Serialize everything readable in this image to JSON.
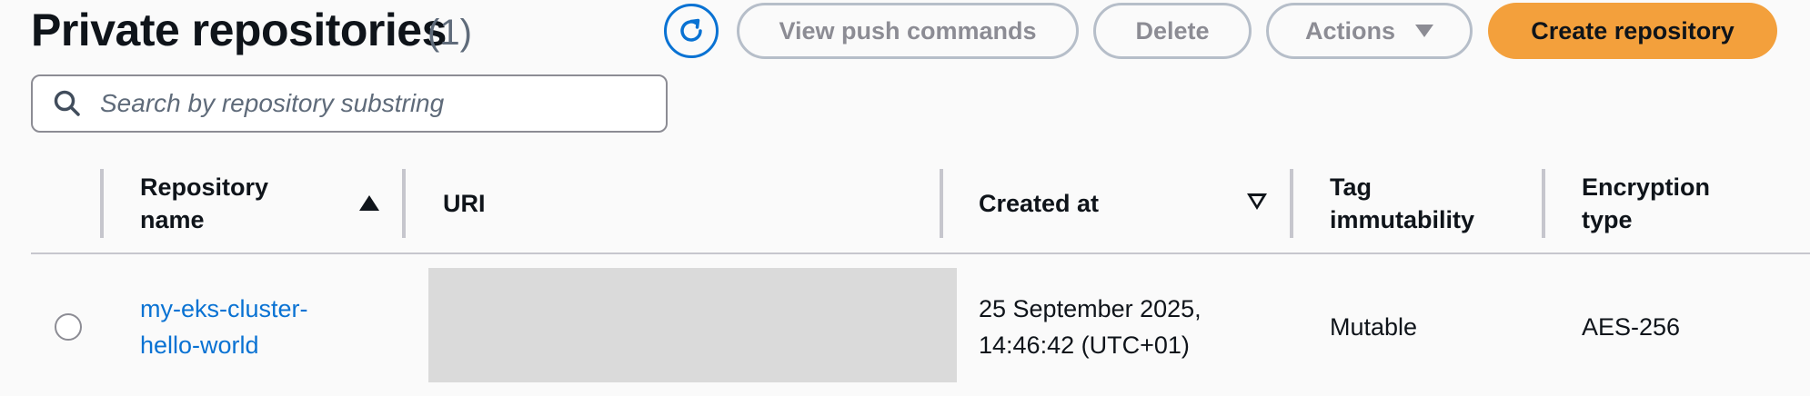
{
  "header": {
    "title": "Private repositories",
    "count": "(1)"
  },
  "toolbar": {
    "refresh_icon": "refresh-icon",
    "view_push_commands": "View push commands",
    "delete": "Delete",
    "actions": "Actions",
    "create_repository": "Create repository"
  },
  "search": {
    "placeholder": "Search by repository substring"
  },
  "table": {
    "columns": [
      {
        "label_line1": "Repository",
        "label_line2": "name",
        "sort": "ascending"
      },
      {
        "label": "URI"
      },
      {
        "label": "Created at",
        "sort": "descending"
      },
      {
        "label_line1": "Tag",
        "label_line2": "immutability"
      },
      {
        "label_line1": "Encryption",
        "label_line2": "type"
      }
    ],
    "rows": [
      {
        "name_line1": "my-eks-cluster-",
        "name_line2": "hello-world",
        "uri": "",
        "created_line1": "25 September 2025,",
        "created_line2": "14:46:42 (UTC+01)",
        "tag_immutability": "Mutable",
        "encryption": "AES-256"
      }
    ]
  },
  "colors": {
    "primary": "#f3a03c",
    "link": "#0972d3",
    "border": "#b6bec9"
  }
}
